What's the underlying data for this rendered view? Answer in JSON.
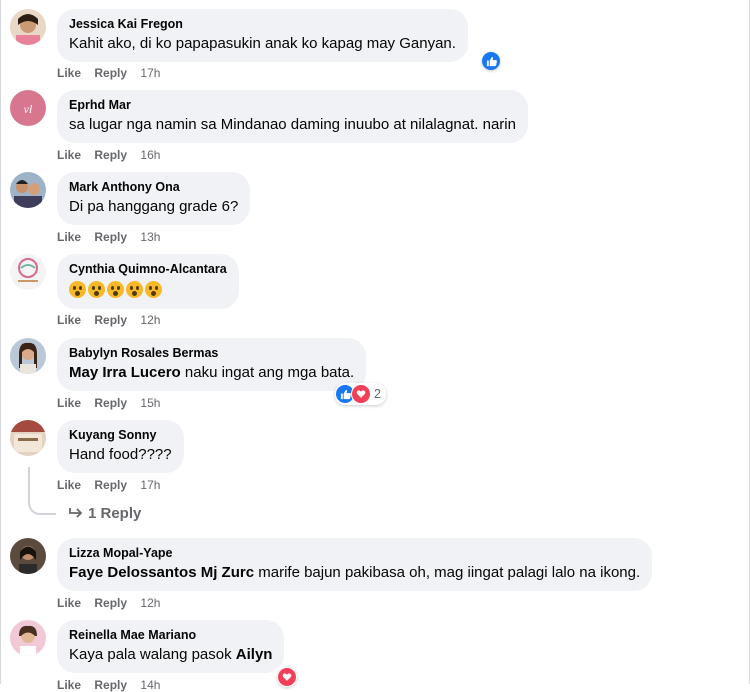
{
  "comments": [
    {
      "author": "Jessica Kai Fregon",
      "text": "Kahit ako, di ko papapasukin anak ko kapag may Ganyan.",
      "like": "Like",
      "reply": "Reply",
      "time": "17h"
    },
    {
      "author": "Eprhd Mar",
      "text": "sa lugar nga namin sa Mindanao daming inuubo at nilalagnat. narin",
      "like": "Like",
      "reply": "Reply",
      "time": "16h"
    },
    {
      "author": "Mark Anthony Ona",
      "text": "Di pa hanggang grade 6?",
      "like": "Like",
      "reply": "Reply",
      "time": "13h"
    },
    {
      "author": "Cynthia Quimno-Alcantara",
      "emoji_count": 5,
      "like": "Like",
      "reply": "Reply",
      "time": "12h"
    },
    {
      "author": "Babylyn Rosales Bermas",
      "mention": "May Irra Lucero",
      "text": " naku ingat ang mga bata.",
      "like": "Like",
      "reply": "Reply",
      "time": "15h",
      "reaction_count": "2"
    },
    {
      "author": "Kuyang Sonny",
      "text": "Hand food????",
      "like": "Like",
      "reply": "Reply",
      "time": "17h",
      "view_replies": "1 Reply"
    },
    {
      "author": "Lizza Mopal-Yape",
      "mention": "Faye Delossantos Mj Zurc",
      "text": " marife bajun pakibasa oh, mag iingat palagi lalo na ikong.",
      "like": "Like",
      "reply": "Reply",
      "time": "12h"
    },
    {
      "author": "Reinella Mae Mariano",
      "text": "Kaya pala walang pasok ",
      "mention": "Ailyn",
      "like": "Like",
      "reply": "Reply",
      "time": "14h"
    }
  ],
  "icons": {
    "like": "like-icon",
    "love": "love-icon",
    "reply_arrow": "reply-arrow-icon"
  },
  "colors": {
    "like": "#1877f2",
    "love": "#f33e58",
    "bubble": "#f0f2f5",
    "meta": "#65676b"
  }
}
